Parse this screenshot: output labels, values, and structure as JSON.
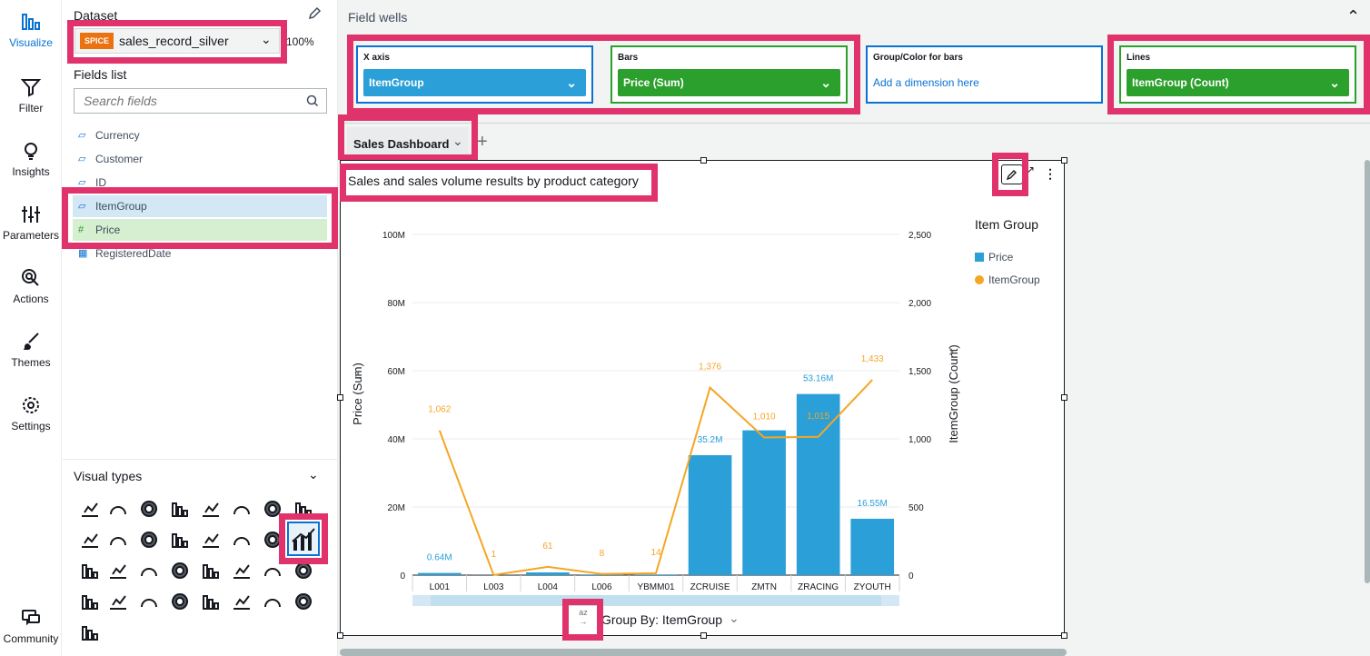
{
  "nav": {
    "items": [
      {
        "label": "Visualize",
        "icon": "visualize-icon"
      },
      {
        "label": "Filter",
        "icon": "filter-icon"
      },
      {
        "label": "Insights",
        "icon": "insights-icon"
      },
      {
        "label": "Parameters",
        "icon": "parameters-icon"
      },
      {
        "label": "Actions",
        "icon": "actions-icon"
      },
      {
        "label": "Themes",
        "icon": "themes-icon"
      },
      {
        "label": "Settings",
        "icon": "settings-icon"
      },
      {
        "label": "Community",
        "icon": "community-icon"
      }
    ]
  },
  "dataset": {
    "title": "Dataset",
    "badge": "SPICE",
    "name": "sales_record_silver",
    "percent": "100%"
  },
  "fields": {
    "title": "Fields list",
    "search_placeholder": "Search fields",
    "items": [
      {
        "label": "Currency",
        "type": "dimension"
      },
      {
        "label": "Customer",
        "type": "dimension"
      },
      {
        "label": "ID",
        "type": "dimension"
      },
      {
        "label": "ItemGroup",
        "type": "dimension",
        "selected": true
      },
      {
        "label": "Price",
        "type": "measure",
        "selected": true
      },
      {
        "label": "RegisteredDate",
        "type": "date"
      }
    ]
  },
  "visual_types": {
    "title": "Visual types"
  },
  "field_wells": {
    "title": "Field wells",
    "x_axis": {
      "title": "X axis",
      "value": "ItemGroup"
    },
    "bars": {
      "title": "Bars",
      "value": "Price (Sum)"
    },
    "group_color": {
      "title": "Group/Color for bars",
      "placeholder": "Add a dimension here"
    },
    "lines": {
      "title": "Lines",
      "value": "ItemGroup (Count)"
    }
  },
  "sheet": {
    "tab": "Sales Dashboard",
    "add": "+"
  },
  "visual": {
    "title": "Sales and sales volume results by product category",
    "group_by": "Group By: ItemGroup",
    "sort_icon_text": "az"
  },
  "colors": {
    "accent": "#0972d3",
    "bar": "#2a9fd8",
    "line": "#f5a623",
    "highlight": "#e0336b",
    "pill_blue": "#2a9fd8",
    "pill_green": "#2ca02c"
  },
  "chart_data": {
    "type": "bar",
    "categories": [
      "L001",
      "L003",
      "L004",
      "L006",
      "YBMM01",
      "ZCRUISE",
      "ZMTN",
      "ZRACING",
      "ZYOUTH"
    ],
    "series": [
      {
        "name": "Price",
        "kind": "bar",
        "axis": "left",
        "values": [
          0.64,
          0.03,
          0.8,
          0.2,
          0.2,
          35.2,
          42.5,
          53.16,
          16.55
        ],
        "labels": [
          "0.64M",
          "",
          "",
          "",
          "",
          "35.2M",
          "",
          "53.16M",
          "16.55M"
        ]
      },
      {
        "name": "ItemGroup",
        "kind": "line",
        "axis": "right",
        "values": [
          1062,
          1,
          61,
          8,
          14,
          1376,
          1010,
          1015,
          1433
        ],
        "labels": [
          "1,062",
          "1",
          "61",
          "8",
          "14",
          "1,376",
          "1,010",
          "1,015",
          "1,433"
        ]
      }
    ],
    "ylabel": "Price (Sum)",
    "y2label": "ItemGroup (Count)",
    "ylim": [
      0,
      100
    ],
    "y2lim": [
      0,
      2500
    ],
    "yticks": [
      "0",
      "20M",
      "40M",
      "60M",
      "80M",
      "100M"
    ],
    "y2ticks": [
      "0",
      "500",
      "1,000",
      "1,500",
      "2,000",
      "2,500"
    ],
    "legend_title": "Item Group",
    "legend": [
      "Price",
      "ItemGroup"
    ],
    "legend_position": "right"
  }
}
